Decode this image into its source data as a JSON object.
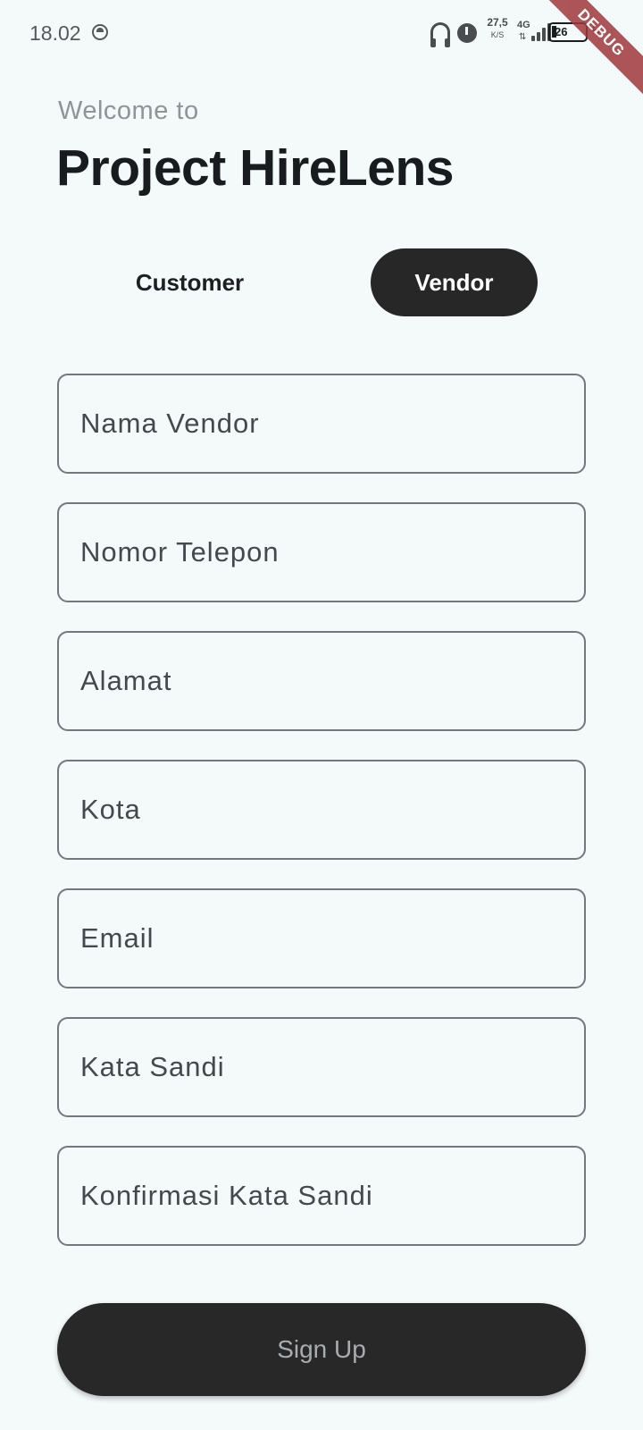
{
  "status_bar": {
    "time": "18.02",
    "net_speed_value": "27,5",
    "net_speed_unit": "K/S",
    "network_type": "4G",
    "network_arrows": "⇅",
    "battery_level": "26",
    "charging_symbol": "ϟ"
  },
  "debug_banner": "DEBUG",
  "header": {
    "welcome": "Welcome to",
    "title": "Project HireLens"
  },
  "role_tabs": {
    "customer": "Customer",
    "vendor": "Vendor",
    "selected": "Vendor"
  },
  "form": {
    "vendor_name_placeholder": "Nama Vendor",
    "phone_placeholder": "Nomor Telepon",
    "address_placeholder": "Alamat",
    "city_placeholder": "Kota",
    "email_placeholder": "Email",
    "password_placeholder": "Kata Sandi",
    "confirm_password_placeholder": "Konfirmasi Kata Sandi"
  },
  "signup_label": "Sign Up",
  "colors": {
    "background": "#f4f9f9",
    "accent_dark": "#272727",
    "field_border": "#74777b",
    "debug_banner": "#a0383d"
  }
}
